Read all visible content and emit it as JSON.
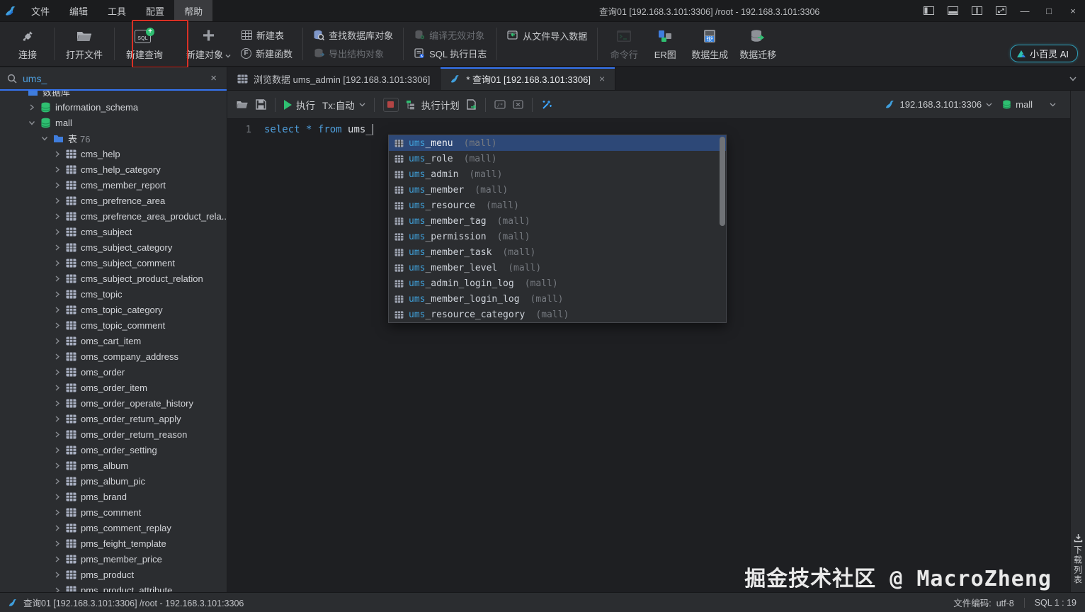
{
  "titlebar": {
    "title": "查询01 [192.168.3.101:3306] /root  -  192.168.3.101:3306",
    "menus": [
      {
        "label": "文件"
      },
      {
        "label": "编辑"
      },
      {
        "label": "工具"
      },
      {
        "label": "配置"
      },
      {
        "label": "帮助",
        "active": true
      }
    ]
  },
  "toolbar": {
    "connect": "连接",
    "open_file": "打开文件",
    "new_query": "新建查询",
    "new_object": "新建对象",
    "new_table": "新建表",
    "new_function": "新建函数",
    "find_db_objects": "查找数据库对象",
    "export_struct": "导出结构对象",
    "compile_invalid": "编译无效对象",
    "sql_log": "SQL 执行日志",
    "import_data": "从文件导入数据",
    "cmdline": "命令行",
    "er_diagram": "ER图",
    "data_gen": "数据生成",
    "data_migrate": "数据迁移",
    "ai_button": "小百灵 AI"
  },
  "sidebar": {
    "search_value": "ums_",
    "tree": {
      "root_label": "数据库",
      "schema1": "information_schema",
      "schema2": "mall",
      "tables_label": "表",
      "tables_count": "76",
      "tables": [
        "cms_help",
        "cms_help_category",
        "cms_member_report",
        "cms_prefrence_area",
        "cms_prefrence_area_product_rela...",
        "cms_subject",
        "cms_subject_category",
        "cms_subject_comment",
        "cms_subject_product_relation",
        "cms_topic",
        "cms_topic_category",
        "cms_topic_comment",
        "oms_cart_item",
        "oms_company_address",
        "oms_order",
        "oms_order_item",
        "oms_order_operate_history",
        "oms_order_return_apply",
        "oms_order_return_reason",
        "oms_order_setting",
        "pms_album",
        "pms_album_pic",
        "pms_brand",
        "pms_comment",
        "pms_comment_replay",
        "pms_feight_template",
        "pms_member_price",
        "pms_product",
        "pms_product_attribute"
      ]
    }
  },
  "tabs": {
    "tab1": "浏览数据 ums_admin [192.168.3.101:3306]",
    "tab2": "* 查询01 [192.168.3.101:3306]"
  },
  "editor_toolbar": {
    "run": "执行",
    "tx": "Tx:自动",
    "explain": "执行计划",
    "connection": "192.168.3.101:3306",
    "database": "mall"
  },
  "editor": {
    "line_number": "1",
    "tokens": {
      "kw1": "select",
      "op": "*",
      "kw2": "from",
      "ident": "ums_"
    }
  },
  "autocomplete": {
    "items": [
      {
        "prefix": "ums",
        "rest": "_menu",
        "db": "(mall)",
        "selected": true
      },
      {
        "prefix": "ums",
        "rest": "_role",
        "db": "(mall)"
      },
      {
        "prefix": "ums",
        "rest": "_admin",
        "db": "(mall)"
      },
      {
        "prefix": "ums",
        "rest": "_member",
        "db": "(mall)"
      },
      {
        "prefix": "ums",
        "rest": "_resource",
        "db": "(mall)"
      },
      {
        "prefix": "ums",
        "rest": "_member_tag",
        "db": "(mall)"
      },
      {
        "prefix": "ums",
        "rest": "_permission",
        "db": "(mall)"
      },
      {
        "prefix": "ums",
        "rest": "_member_task",
        "db": "(mall)"
      },
      {
        "prefix": "ums",
        "rest": "_member_level",
        "db": "(mall)"
      },
      {
        "prefix": "ums",
        "rest": "_admin_login_log",
        "db": "(mall)"
      },
      {
        "prefix": "ums",
        "rest": "_member_login_log",
        "db": "(mall)"
      },
      {
        "prefix": "ums",
        "rest": "_resource_category",
        "db": "(mall)"
      }
    ]
  },
  "watermark": "掘金技术社区 @ MacroZheng",
  "right_strip": {
    "download_label": "下载列表"
  },
  "statusbar": {
    "left": "查询01 [192.168.3.101:3306] /root - 192.168.3.101:3306",
    "encoding_label": "文件编码:",
    "encoding": "utf-8",
    "sql_pos": "SQL 1 : 19"
  },
  "colors": {
    "accent_blue": "#3574f0",
    "keyword_blue": "#4f9fdd",
    "db_green": "#2fbf71",
    "annotation_red": "#d93025",
    "autocomplete_selected": "#2d4877"
  }
}
